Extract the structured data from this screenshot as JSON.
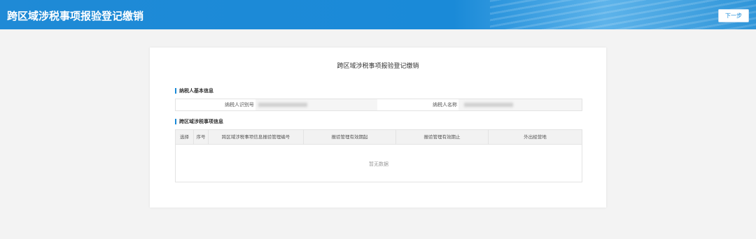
{
  "header": {
    "title": "跨区域涉税事项报验登记缴销",
    "next_label": "下一步"
  },
  "panel": {
    "title": "跨区域涉税事项报验登记缴销"
  },
  "basic_info": {
    "section_title": "纳税人基本信息",
    "taxpayer_id_label": "纳税人识别号",
    "taxpayer_name_label": "纳税人名称"
  },
  "matters": {
    "section_title": "跨区域涉税事项信息",
    "columns": [
      "选择",
      "序号",
      "跨区域涉税事项信息报验管理编号",
      "报验管理有效期起",
      "报验管理有效期止",
      "外出经营地"
    ],
    "empty_text": "暂无数据"
  }
}
